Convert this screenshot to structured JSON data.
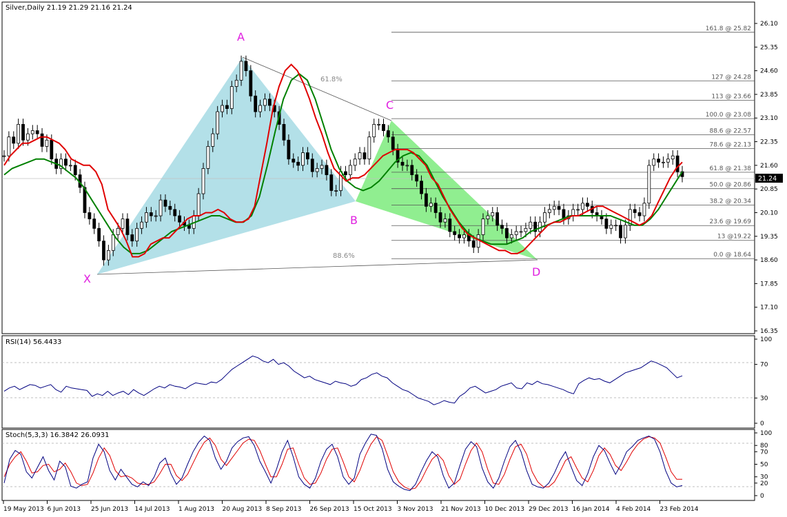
{
  "main_panel": {
    "header": "Silver,Daily  21.19 21.29 21.16 21.24",
    "price_axis_ticks": [
      "26.10",
      "25.35",
      "24.60",
      "23.85",
      "23.10",
      "22.35",
      "21.60",
      "20.85",
      "20.10",
      "19.35",
      "18.60",
      "17.85",
      "17.10",
      "16.35"
    ],
    "current_price_label": "21.24",
    "pattern_labels": [
      "X",
      "A",
      "B",
      "C",
      "D"
    ],
    "ratio_labels": [
      "61.8%",
      "88.6%"
    ],
    "fib_levels": [
      {
        "label": "161.8 @ 25.82",
        "price": 25.82
      },
      {
        "label": "127 @ 24.28",
        "price": 24.28
      },
      {
        "label": "113 @ 23.66",
        "price": 23.66
      },
      {
        "label": "100.0 @ 23.08",
        "price": 23.08
      },
      {
        "label": "88.6 @ 22.57",
        "price": 22.57
      },
      {
        "label": "78.6 @ 22.13",
        "price": 22.13
      },
      {
        "label": "61.8 @ 21.38",
        "price": 21.38
      },
      {
        "label": "50.0 @ 20.86",
        "price": 20.86
      },
      {
        "label": "38.2 @ 20.34",
        "price": 20.34
      },
      {
        "label": "23.6 @ 19.69",
        "price": 19.69
      },
      {
        "label": "13 @19.22",
        "price": 19.22
      },
      {
        "label": "0.0 @ 18.64",
        "price": 18.64
      }
    ]
  },
  "rsi_panel": {
    "header": "RSI(14) 56.4433",
    "axis_ticks": [
      "100",
      "70",
      "30",
      "0"
    ]
  },
  "stoch_panel": {
    "header": "Stoch(5,3,3) 16.3842 26.0931",
    "axis_ticks": [
      "100",
      "80",
      "70",
      "50",
      "30",
      "20",
      "0"
    ]
  },
  "date_axis": [
    "19 May 2013",
    "6 Jun 2013",
    "25 Jun 2013",
    "14 Jul 2013",
    "1 Aug 2013",
    "20 Aug 2013",
    "8 Sep 2013",
    "26 Sep 2013",
    "15 Oct 2013",
    "3 Nov 2013",
    "21 Nov 2013",
    "10 Dec 2013",
    "29 Dec 2013",
    "16 Jan 2014",
    "4 Feb 2014",
    "23 Feb 2014"
  ],
  "chart_data": [
    {
      "type": "candlestick",
      "title": "Silver,Daily",
      "ohlc_last": {
        "open": 21.19,
        "high": 21.29,
        "low": 21.16,
        "close": 21.24
      },
      "ylim": [
        16.35,
        26.48
      ],
      "date_range": [
        "2013-05-19",
        "2014-02-27"
      ],
      "harmonic_points": [
        {
          "name": "X",
          "date": "2013-06-27",
          "price": 18.1
        },
        {
          "name": "A",
          "date": "2013-08-28",
          "price": 25.1
        },
        {
          "name": "B",
          "date": "2013-10-12",
          "price": 20.45
        },
        {
          "name": "C",
          "date": "2013-10-30",
          "price": 23.08
        },
        {
          "name": "D",
          "date": "2013-12-31",
          "price": 18.64
        }
      ],
      "series": [
        {
          "name": "Close",
          "values": [
            21.9,
            22.5,
            22.3,
            22.9,
            22.4,
            22.6,
            22.7,
            22.6,
            22.2,
            22.4,
            21.8,
            21.5,
            21.8,
            21.6,
            21.6,
            21.3,
            20.9,
            20.1,
            19.9,
            19.6,
            19.2,
            18.6,
            18.9,
            19.4,
            19.6,
            19.9,
            19.4,
            19.2,
            19.6,
            19.8,
            20.1,
            20.0,
            20.0,
            20.5,
            20.3,
            20.2,
            20.0,
            19.8,
            19.7,
            19.6,
            20.0,
            20.7,
            21.5,
            22.2,
            22.6,
            23.3,
            23.5,
            23.4,
            24.1,
            24.3,
            24.9,
            24.6,
            23.8,
            23.3,
            23.5,
            23.7,
            23.5,
            23.3,
            22.9,
            22.4,
            21.8,
            21.7,
            21.6,
            22.0,
            21.8,
            21.4,
            21.5,
            21.6,
            21.3,
            20.8,
            20.8,
            21.4,
            21.3,
            21.6,
            21.8,
            22.0,
            21.8,
            22.5,
            22.9,
            22.9,
            22.7,
            22.5,
            22.1,
            21.7,
            21.6,
            21.6,
            21.3,
            21.1,
            20.7,
            20.3,
            20.4,
            20.1,
            19.8,
            19.9,
            19.5,
            19.4,
            19.3,
            19.4,
            19.2,
            19.0,
            19.4,
            19.9,
            20.0,
            20.1,
            19.7,
            19.6,
            19.3,
            19.4,
            19.5,
            19.5,
            19.6,
            19.8,
            19.5,
            19.8,
            20.1,
            20.2,
            20.3,
            20.2,
            19.9,
            20.0,
            20.2,
            20.2,
            20.4,
            20.3,
            20.1,
            20.0,
            19.9,
            19.6,
            19.7,
            19.7,
            19.3,
            19.7,
            20.2,
            20.1,
            20.0,
            20.4,
            21.6,
            21.8,
            21.7,
            21.7,
            21.8,
            21.9,
            21.4,
            21.24
          ]
        },
        {
          "name": "MA fast (red)",
          "values": [
            21.6,
            21.9,
            22.1,
            22.3,
            22.3,
            22.4,
            22.5,
            22.5,
            22.4,
            22.3,
            22.1,
            21.8,
            21.7,
            21.6,
            21.6,
            21.4,
            21.0,
            20.2,
            19.9,
            19.6,
            19.2,
            18.7,
            18.7,
            18.8,
            19.1,
            19.2,
            19.3,
            19.3,
            19.5,
            19.7,
            19.9,
            20.0,
            20.0,
            20.1,
            20.1,
            20.2,
            20.1,
            19.9,
            19.8,
            19.8,
            19.9,
            20.3,
            21.3,
            22.3,
            23.4,
            24.1,
            24.6,
            24.8,
            24.6,
            24.2,
            23.7,
            23.1,
            22.6,
            22.0,
            21.5,
            21.3,
            21.1,
            21.2,
            21.2,
            21.3,
            21.5,
            21.7,
            21.9,
            22.0,
            22.1,
            22.1,
            22.1,
            22.0,
            21.8,
            21.6,
            21.2,
            21.0,
            20.6,
            20.2,
            19.9,
            19.6,
            19.4,
            19.3,
            19.2,
            19.1,
            19.0,
            18.9,
            18.9,
            18.8,
            18.8,
            18.9,
            19.1,
            19.3,
            19.5,
            19.7,
            19.8,
            19.8,
            19.9,
            20.0,
            20.0,
            20.1,
            20.2,
            20.3,
            20.3,
            20.2,
            20.1,
            20.0,
            19.9,
            19.8,
            19.7,
            19.8,
            20.0,
            20.4,
            20.8,
            21.2,
            21.5,
            21.7
          ]
        },
        {
          "name": "MA slow (green)",
          "values": [
            21.3,
            21.5,
            21.6,
            21.7,
            21.8,
            21.8,
            21.7,
            21.6,
            21.4,
            21.2,
            20.9,
            20.5,
            20.1,
            19.7,
            19.3,
            19.0,
            18.8,
            18.8,
            18.9,
            19.1,
            19.3,
            19.5,
            19.6,
            19.7,
            19.8,
            19.9,
            20.0,
            20.0,
            19.9,
            19.8,
            19.8,
            20.0,
            20.6,
            21.6,
            22.7,
            23.7,
            24.3,
            24.5,
            24.3,
            23.7,
            22.9,
            22.1,
            21.5,
            21.1,
            20.9,
            20.8,
            20.9,
            21.1,
            21.4,
            21.7,
            21.9,
            22.0,
            21.9,
            21.6,
            21.1,
            20.6,
            20.2,
            19.8,
            19.5,
            19.3,
            19.2,
            19.1,
            19.1,
            19.1,
            19.2,
            19.3,
            19.5,
            19.6,
            19.7,
            19.8,
            19.9,
            20.0,
            20.0,
            20.0,
            20.0,
            20.0,
            20.0,
            19.9,
            19.8,
            19.7,
            19.7,
            19.9,
            20.2,
            20.6,
            21.0,
            21.4
          ]
        }
      ]
    },
    {
      "type": "line",
      "title": "RSI(14) 56.4433",
      "ylim": [
        0,
        100
      ],
      "reference_lines": [
        70,
        30
      ],
      "series": [
        {
          "name": "RSI(14)",
          "values": [
            38,
            42,
            44,
            40,
            43,
            46,
            45,
            42,
            44,
            46,
            40,
            37,
            44,
            42,
            41,
            40,
            39,
            32,
            35,
            33,
            38,
            33,
            36,
            38,
            34,
            40,
            36,
            33,
            37,
            41,
            44,
            42,
            46,
            44,
            43,
            41,
            45,
            48,
            47,
            46,
            49,
            48,
            52,
            58,
            64,
            68,
            72,
            76,
            80,
            78,
            74,
            72,
            76,
            70,
            72,
            68,
            62,
            58,
            54,
            56,
            52,
            50,
            48,
            46,
            50,
            48,
            47,
            44,
            46,
            52,
            54,
            58,
            60,
            56,
            54,
            48,
            44,
            40,
            38,
            34,
            30,
            28,
            26,
            22,
            24,
            27,
            25,
            24,
            32,
            36,
            42,
            44,
            40,
            36,
            38,
            40,
            44,
            46,
            48,
            42,
            41,
            48,
            46,
            50,
            47,
            46,
            44,
            42,
            40,
            37,
            35,
            47,
            51,
            54,
            52,
            53,
            50,
            48,
            52,
            56,
            60,
            62,
            64,
            66,
            70,
            74,
            72,
            69,
            66,
            60,
            54,
            56.4
          ]
        }
      ]
    },
    {
      "type": "line",
      "title": "Stoch(5,3,3) 16.3842 26.0931",
      "ylim": [
        0,
        100
      ],
      "reference_lines": [
        80,
        20
      ],
      "series": [
        {
          "name": "%K",
          "values": [
            20,
            58,
            72,
            66,
            38,
            28,
            45,
            62,
            40,
            25,
            55,
            46,
            15,
            12,
            18,
            22,
            60,
            82,
            70,
            40,
            25,
            42,
            30,
            18,
            14,
            22,
            16,
            30,
            52,
            60,
            35,
            18,
            28,
            50,
            70,
            85,
            95,
            88,
            60,
            42,
            55,
            76,
            86,
            92,
            94,
            80,
            55,
            38,
            20,
            42,
            70,
            88,
            62,
            30,
            18,
            12,
            28,
            55,
            74,
            82,
            62,
            30,
            18,
            28,
            66,
            84,
            98,
            96,
            75,
            42,
            22,
            15,
            10,
            8,
            18,
            38,
            56,
            70,
            62,
            32,
            12,
            20,
            48,
            74,
            86,
            78,
            44,
            22,
            12,
            28,
            55,
            78,
            88,
            70,
            40,
            18,
            14,
            12,
            20,
            36,
            56,
            70,
            46,
            24,
            16,
            35,
            62,
            80,
            72,
            52,
            34,
            50,
            70,
            78,
            88,
            92,
            95,
            90,
            70,
            40,
            20,
            14,
            16
          ]
        },
        {
          "name": "%D",
          "values": [
            30,
            50,
            62,
            70,
            55,
            36,
            38,
            48,
            50,
            38,
            42,
            52,
            38,
            20,
            16,
            18,
            36,
            60,
            76,
            64,
            40,
            30,
            32,
            28,
            20,
            18,
            18,
            22,
            35,
            50,
            50,
            32,
            24,
            34,
            52,
            70,
            85,
            92,
            80,
            58,
            48,
            60,
            72,
            84,
            90,
            88,
            72,
            50,
            30,
            30,
            50,
            74,
            76,
            50,
            28,
            18,
            20,
            36,
            58,
            74,
            76,
            54,
            30,
            22,
            40,
            64,
            82,
            94,
            88,
            64,
            38,
            22,
            14,
            10,
            12,
            24,
            42,
            58,
            66,
            56,
            32,
            18,
            26,
            50,
            72,
            84,
            70,
            42,
            20,
            18,
            34,
            58,
            78,
            82,
            66,
            38,
            22,
            14,
            14,
            22,
            38,
            56,
            62,
            44,
            28,
            22,
            40,
            64,
            76,
            66,
            48,
            40,
            54,
            70,
            82,
            90,
            94,
            92,
            84,
            62,
            38,
            26,
            26
          ]
        }
      ]
    }
  ]
}
